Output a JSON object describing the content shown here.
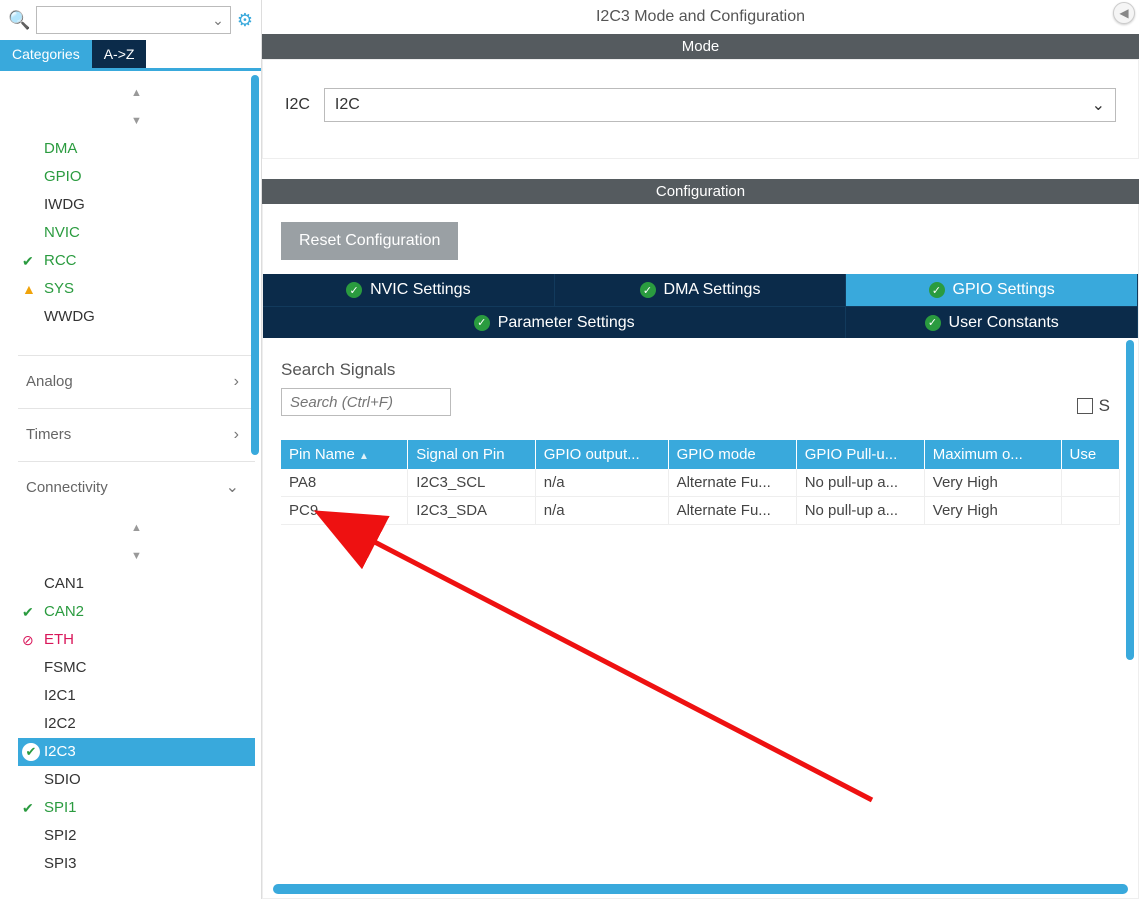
{
  "leftTabs": {
    "categories": "Categories",
    "az": "A->Z"
  },
  "sidebar": {
    "group1": [
      {
        "label": "DMA",
        "cls": "green",
        "badge": ""
      },
      {
        "label": "GPIO",
        "cls": "green",
        "badge": ""
      },
      {
        "label": "IWDG",
        "cls": "black",
        "badge": ""
      },
      {
        "label": "NVIC",
        "cls": "green",
        "badge": ""
      },
      {
        "label": "RCC",
        "cls": "green",
        "badge": "check"
      },
      {
        "label": "SYS",
        "cls": "green",
        "badge": "warn"
      },
      {
        "label": "WWDG",
        "cls": "black",
        "badge": ""
      }
    ],
    "sections": [
      {
        "label": "Analog",
        "chev": "›"
      },
      {
        "label": "Timers",
        "chev": "›"
      },
      {
        "label": "Connectivity",
        "chev": "⌄"
      }
    ],
    "connectivity": [
      {
        "label": "CAN1",
        "cls": "black",
        "badge": ""
      },
      {
        "label": "CAN2",
        "cls": "green",
        "badge": "check"
      },
      {
        "label": "ETH",
        "cls": "pink",
        "badge": "ban"
      },
      {
        "label": "FSMC",
        "cls": "black",
        "badge": ""
      },
      {
        "label": "I2C1",
        "cls": "black",
        "badge": ""
      },
      {
        "label": "I2C2",
        "cls": "black",
        "badge": ""
      },
      {
        "label": "I2C3",
        "cls": "selected",
        "badge": "checkfill"
      },
      {
        "label": "SDIO",
        "cls": "black",
        "badge": ""
      },
      {
        "label": "SPI1",
        "cls": "green",
        "badge": "check"
      },
      {
        "label": "SPI2",
        "cls": "black",
        "badge": ""
      },
      {
        "label": "SPI3",
        "cls": "black",
        "badge": ""
      }
    ]
  },
  "right": {
    "title": "I2C3 Mode and Configuration",
    "modeHeader": "Mode",
    "modeLabel": "I2C",
    "modeValue": "I2C",
    "configHeader": "Configuration",
    "resetBtn": "Reset Configuration",
    "cfgTabs": {
      "nvic": "NVIC Settings",
      "dma": "DMA Settings",
      "gpio": "GPIO Settings",
      "param": "Parameter Settings",
      "user": "User Constants"
    },
    "searchLabel": "Search Signals",
    "searchPlaceholder": "Search (Ctrl+F)",
    "checkboxTail": "S",
    "table": {
      "headers": [
        "Pin Name",
        "Signal on Pin",
        "GPIO output...",
        "GPIO mode",
        "GPIO Pull-u...",
        "Maximum o...",
        "Use"
      ],
      "rows": [
        [
          "PA8",
          "I2C3_SCL",
          "n/a",
          "Alternate Fu...",
          "No pull-up a...",
          "Very High",
          ""
        ],
        [
          "PC9",
          "I2C3_SDA",
          "n/a",
          "Alternate Fu...",
          "No pull-up a...",
          "Very High",
          ""
        ]
      ]
    }
  }
}
